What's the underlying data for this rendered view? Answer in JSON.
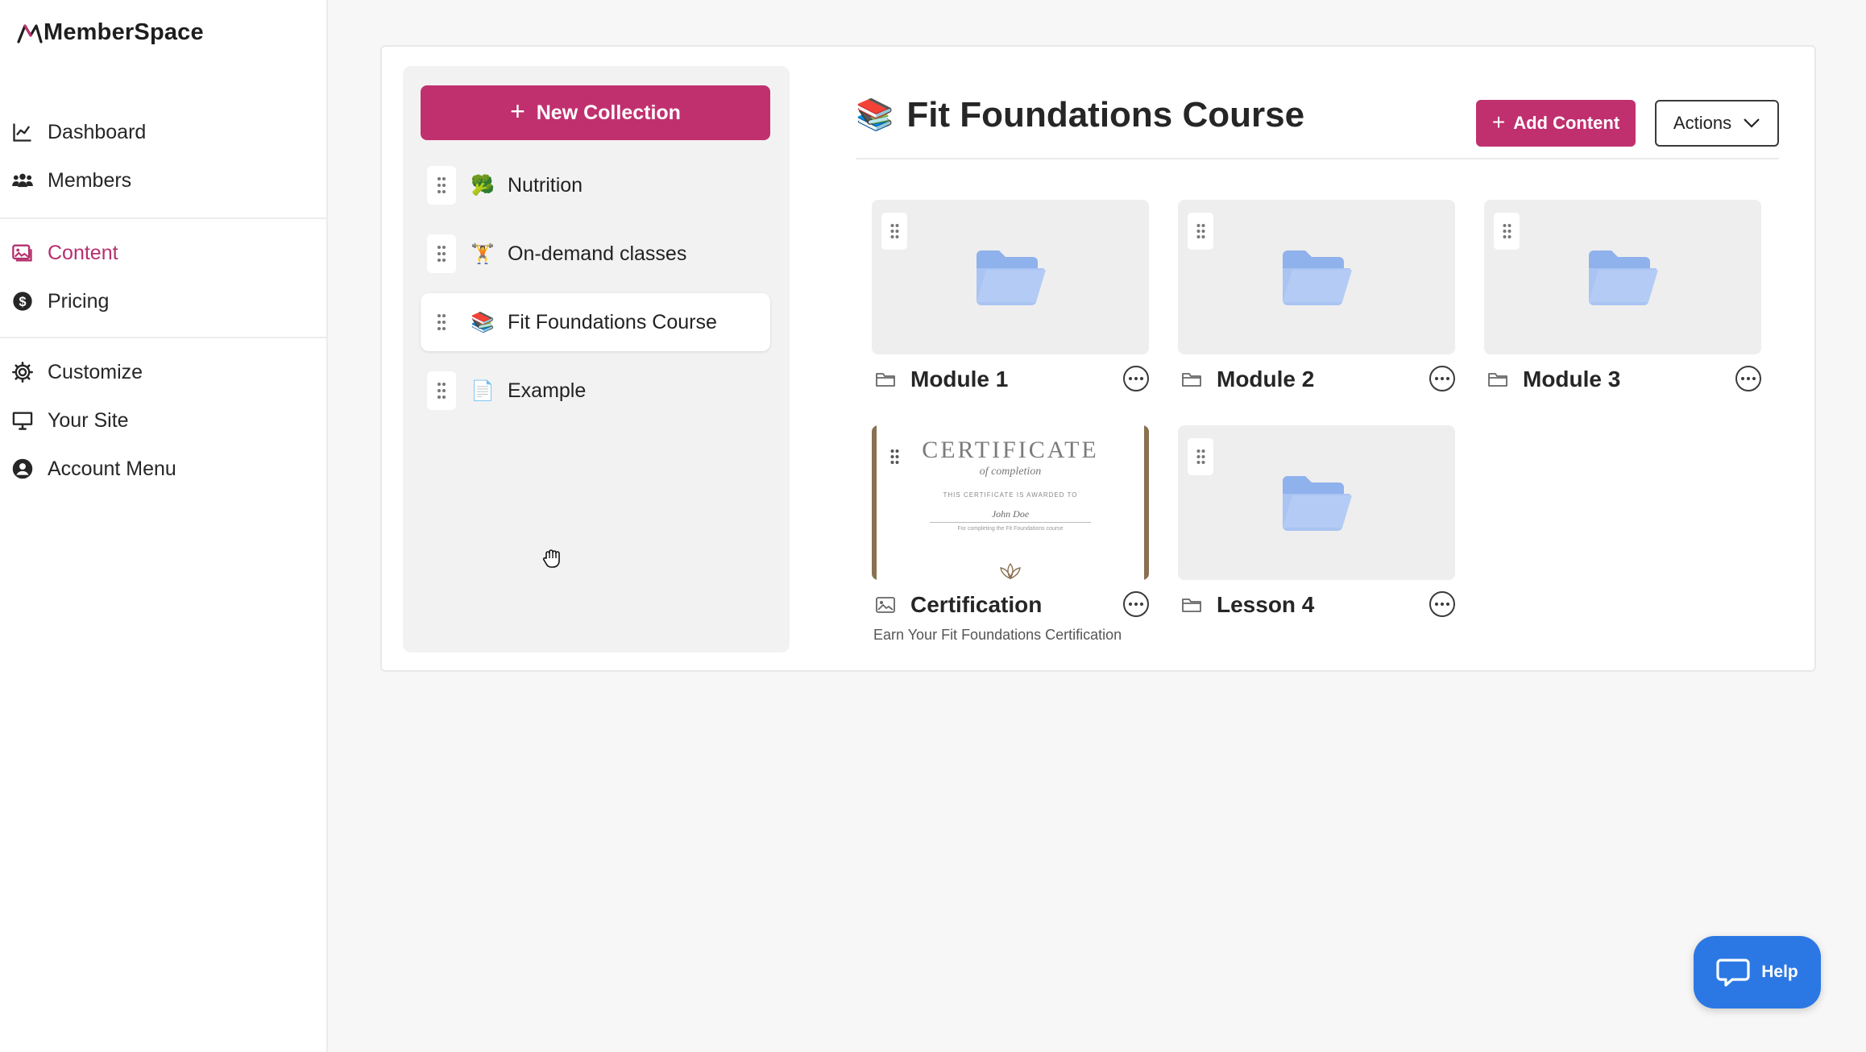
{
  "app": {
    "brand": "MemberSpace"
  },
  "sidebar": {
    "items": [
      {
        "label": "Dashboard",
        "icon": "line-chart-icon",
        "active": false
      },
      {
        "label": "Members",
        "icon": "users-icon",
        "active": false
      },
      {
        "label": "Content",
        "icon": "images-icon",
        "active": true
      },
      {
        "label": "Pricing",
        "icon": "dollar-circle-icon",
        "active": false
      },
      {
        "label": "Customize",
        "icon": "gear-icon",
        "active": false
      },
      {
        "label": "Your Site",
        "icon": "monitor-icon",
        "active": false
      },
      {
        "label": "Account Menu",
        "icon": "user-circle-icon",
        "active": false
      }
    ]
  },
  "collections": {
    "new_button": "New Collection",
    "items": [
      {
        "label": "Nutrition",
        "emoji": "🥦",
        "selected": false
      },
      {
        "label": "On-demand classes",
        "emoji": "🏋",
        "selected": true
      },
      {
        "label": "Fit Foundations Course",
        "emoji": "📚",
        "selected": true
      },
      {
        "label": "Example",
        "emoji": "📄",
        "selected": false
      }
    ]
  },
  "content": {
    "title": "Fit Foundations Course",
    "title_emoji": "📚",
    "add_content": "Add Content",
    "actions": "Actions",
    "tiles": [
      {
        "title": "Module 1",
        "type": "folder"
      },
      {
        "title": "Module 2",
        "type": "folder"
      },
      {
        "title": "Module 3",
        "type": "folder"
      },
      {
        "title": "Certification",
        "type": "image",
        "description": "Earn Your Fit Foundations Certification"
      },
      {
        "title": "Lesson 4",
        "type": "folder"
      }
    ]
  },
  "certificate": {
    "heading": "CERTIFICATE",
    "subheading": "of completion",
    "awarded": "THIS CERTIFICATE IS AWARDED TO",
    "name": "John Doe",
    "reason": "For completing the Fit Foundations course"
  },
  "help": {
    "label": "Help"
  },
  "colors": {
    "brand": "#c0306f",
    "help": "#2b78e4",
    "folder": "#a9c4f2"
  }
}
